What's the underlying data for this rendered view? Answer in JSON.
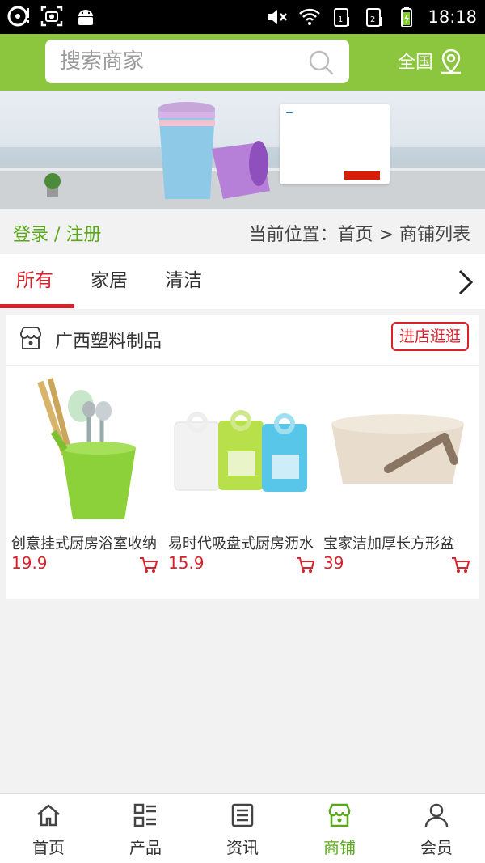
{
  "status_bar": {
    "time": "18:18"
  },
  "header": {
    "search": {
      "placeholder": "搜索商家"
    },
    "region_label": "全国"
  },
  "breadcrumb": {
    "login_register": "登录 / 注册",
    "location": "当前位置：首页 > 商铺列表"
  },
  "tabs": [
    {
      "label": "所有",
      "active": true
    },
    {
      "label": "家居",
      "active": false
    },
    {
      "label": "清洁",
      "active": false
    }
  ],
  "shop": {
    "name": "广西塑料制品",
    "visit_button": "进店逛逛",
    "products": [
      {
        "name": "创意挂式厨房浴室收纳",
        "price": "19.9"
      },
      {
        "name": "易时代吸盘式厨房沥水",
        "price": "15.9"
      },
      {
        "name": "宝家洁加厚长方形盆",
        "price": "39"
      }
    ]
  },
  "bottom_nav": [
    {
      "label": "首页",
      "icon": "home-icon",
      "active": false
    },
    {
      "label": "产品",
      "icon": "product-grid-icon",
      "active": false
    },
    {
      "label": "资讯",
      "icon": "news-icon",
      "active": false
    },
    {
      "label": "商铺",
      "icon": "shop-icon",
      "active": true
    },
    {
      "label": "会员",
      "icon": "user-icon",
      "active": false
    }
  ],
  "colors": {
    "brand_green": "#8cc63f",
    "accent_red": "#d8212b",
    "link_green": "#59a81a"
  }
}
